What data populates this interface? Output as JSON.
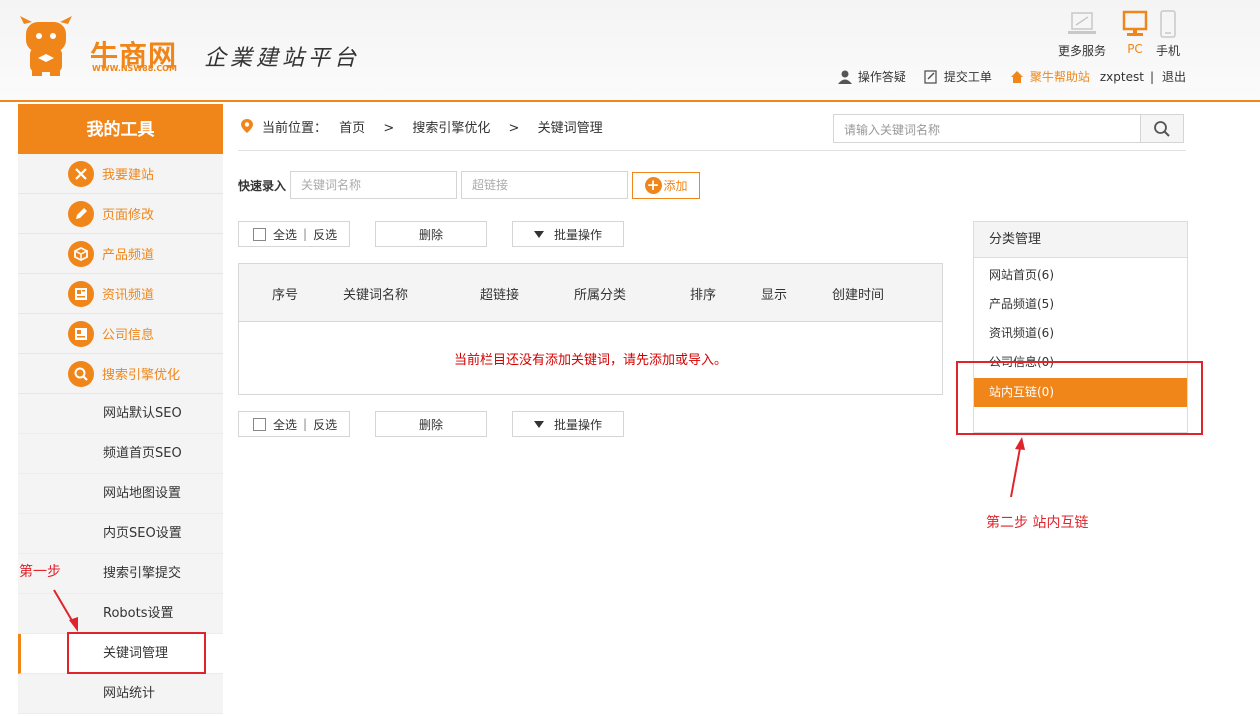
{
  "brand": {
    "name": "牛商网",
    "url": "WWW.NSW88.COM",
    "slogan": "企業建站平台"
  },
  "services": [
    {
      "label": "更多服务",
      "icon": "laptop-icon"
    },
    {
      "label": "PC",
      "icon": "monitor-icon"
    },
    {
      "label": "手机",
      "icon": "phone-icon"
    }
  ],
  "userbar": {
    "ops": "操作答疑",
    "ticket": "提交工单",
    "help": "聚牛帮助站",
    "user": "zxptest",
    "sep": "|",
    "logout": "退出"
  },
  "sidebar": {
    "title": "我的工具",
    "main_items": [
      {
        "label": "我要建站",
        "icon": "tools-icon"
      },
      {
        "label": "页面修改",
        "icon": "pencil-icon"
      },
      {
        "label": "产品频道",
        "icon": "box-icon"
      },
      {
        "label": "资讯频道",
        "icon": "news-icon"
      },
      {
        "label": "公司信息",
        "icon": "company-icon"
      },
      {
        "label": "搜索引擎优化",
        "icon": "search-icon"
      }
    ],
    "sub_items": [
      "网站默认SEO",
      "频道首页SEO",
      "网站地图设置",
      "内页SEO设置",
      "搜索引擎提交",
      "Robots设置",
      "关键词管理",
      "网站统计"
    ]
  },
  "breadcrumb": {
    "prefix": "当前位置：",
    "items": [
      "首页",
      ">",
      "搜索引擎优化",
      ">",
      "关键词管理"
    ]
  },
  "search": {
    "placeholder": "请输入关键词名称"
  },
  "quick_entry": {
    "label": "快速录入",
    "name_placeholder": "关键词名称",
    "link_placeholder": "超链接",
    "add_label": "添加"
  },
  "toolbar": {
    "select_all": "全选",
    "bar": "|",
    "invert": "反选",
    "delete": "删除",
    "batch": "批量操作"
  },
  "table": {
    "columns": [
      "序号",
      "关键词名称",
      "超链接",
      "所属分类",
      "排序",
      "显示",
      "创建时间"
    ],
    "empty_message": "当前栏目还没有添加关键词，请先添加或导入。"
  },
  "category": {
    "title": "分类管理",
    "items": [
      "网站首页(6)",
      "产品频道(5)",
      "资讯频道(6)",
      "公司信息(0)",
      "站内互链(0)"
    ],
    "active_index": 4
  },
  "annotations": {
    "step1": "第一步",
    "step2": "第二步 站内互链"
  },
  "colors": {
    "accent": "#f0861a",
    "annotation": "#e0242b"
  }
}
